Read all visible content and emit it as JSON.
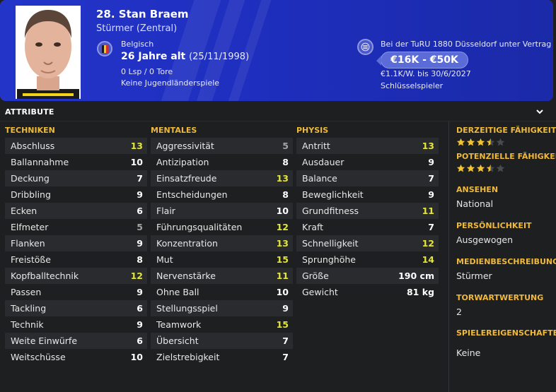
{
  "player": {
    "name": "28. Stan Braem",
    "position": "Stürmer (Zentral)",
    "nationality": "Belgisch",
    "age": "26 Jahre alt",
    "dob": "(25/11/1998)",
    "caps": "0 Lsp / 0 Tore",
    "youth_caps": "Keine Jugendländerspiele",
    "flag_colors": [
      "#1a1a1a",
      "#f5c518",
      "#d62d2d"
    ]
  },
  "contract": {
    "club_line": "Bei der TuRU 1880 Düsseldorf unter Vertrag",
    "value_range": "€16K - €50K",
    "wage_line": "€1.1K/W. bis 30/6/2027",
    "squad_status": "Schlüsselspieler"
  },
  "attributes": {
    "title": "ATTRIBUTE",
    "technical": {
      "heading": "TECHNIKEN",
      "items": [
        {
          "label": "Abschluss",
          "value": "13"
        },
        {
          "label": "Ballannahme",
          "value": "10"
        },
        {
          "label": "Deckung",
          "value": "7"
        },
        {
          "label": "Dribbling",
          "value": "9"
        },
        {
          "label": "Ecken",
          "value": "6"
        },
        {
          "label": "Elfmeter",
          "value": "5"
        },
        {
          "label": "Flanken",
          "value": "9"
        },
        {
          "label": "Freistöße",
          "value": "8"
        },
        {
          "label": "Kopfballtechnik",
          "value": "12"
        },
        {
          "label": "Passen",
          "value": "9"
        },
        {
          "label": "Tackling",
          "value": "6"
        },
        {
          "label": "Technik",
          "value": "9"
        },
        {
          "label": "Weite Einwürfe",
          "value": "6"
        },
        {
          "label": "Weitschüsse",
          "value": "10"
        }
      ]
    },
    "mental": {
      "heading": "MENTALES",
      "items": [
        {
          "label": "Aggressivität",
          "value": "5"
        },
        {
          "label": "Antizipation",
          "value": "8"
        },
        {
          "label": "Einsatzfreude",
          "value": "13"
        },
        {
          "label": "Entscheidungen",
          "value": "8"
        },
        {
          "label": "Flair",
          "value": "10"
        },
        {
          "label": "Führungsqualitäten",
          "value": "12"
        },
        {
          "label": "Konzentration",
          "value": "13"
        },
        {
          "label": "Mut",
          "value": "15"
        },
        {
          "label": "Nervenstärke",
          "value": "11"
        },
        {
          "label": "Ohne Ball",
          "value": "10"
        },
        {
          "label": "Stellungsspiel",
          "value": "9"
        },
        {
          "label": "Teamwork",
          "value": "15"
        },
        {
          "label": "Übersicht",
          "value": "7"
        },
        {
          "label": "Zielstrebigkeit",
          "value": "7"
        }
      ]
    },
    "physical": {
      "heading": "PHYSIS",
      "items": [
        {
          "label": "Antritt",
          "value": "13"
        },
        {
          "label": "Ausdauer",
          "value": "9"
        },
        {
          "label": "Balance",
          "value": "7"
        },
        {
          "label": "Beweglichkeit",
          "value": "9"
        },
        {
          "label": "Grundfitness",
          "value": "11"
        },
        {
          "label": "Kraft",
          "value": "7"
        },
        {
          "label": "Schnelligkeit",
          "value": "12"
        },
        {
          "label": "Sprunghöhe",
          "value": "14"
        },
        {
          "label": "Größe",
          "value": "190 cm"
        },
        {
          "label": "Gewicht",
          "value": "81 kg"
        }
      ]
    }
  },
  "side": {
    "current_ability": {
      "label": "DERZEITIGE FÄHIGKEIT",
      "stars": 3.5,
      "max": 5
    },
    "potential_ability": {
      "label": "POTENZIELLE FÄHIGKEIT",
      "stars": 3.5,
      "max": 5
    },
    "reputation": {
      "label": "ANSEHEN",
      "value": "National"
    },
    "personality": {
      "label": "PERSÖNLICHKEIT",
      "value": "Ausgewogen"
    },
    "media": {
      "label": "MEDIENBESCHREIBUNG",
      "value": "Stürmer"
    },
    "gk_rating": {
      "label": "TORWARTWERTUNG",
      "value": "2"
    },
    "traits": {
      "label": "SPIELEREIGENSCHAFTEN",
      "value": "Keine"
    }
  },
  "colors": {
    "header_blue": "#2335c9",
    "accent_orange": "#f0b93a",
    "high_value_yellow": "#e2e53b",
    "low_value_grey": "#a3a3a3",
    "star_yellow": "#f4c430"
  }
}
